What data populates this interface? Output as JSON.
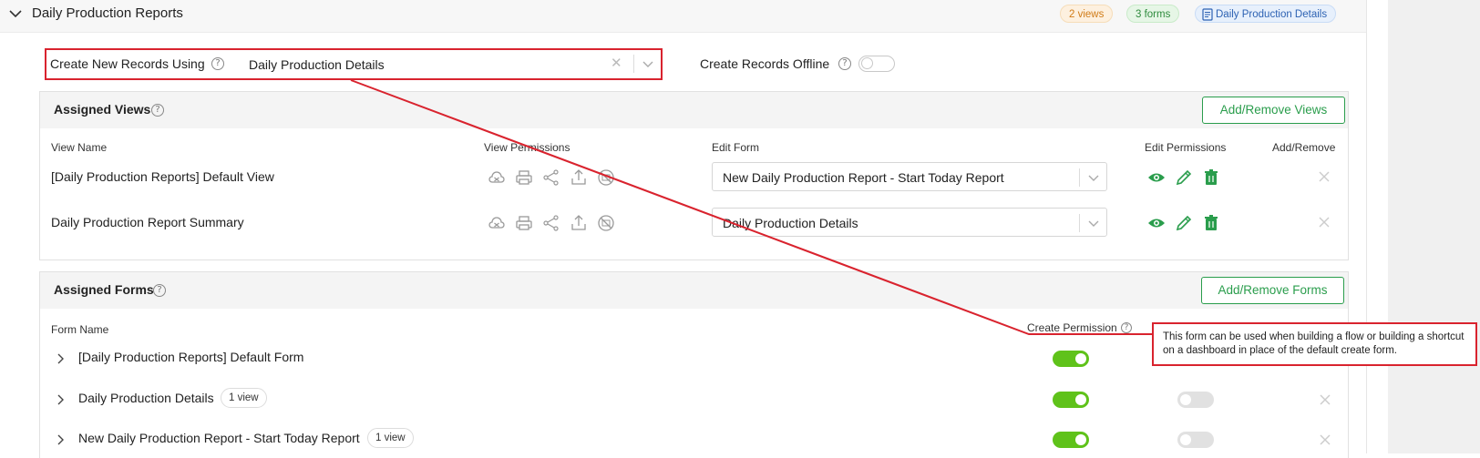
{
  "header": {
    "title": "Daily Production Reports",
    "badges": {
      "views": "2 views",
      "forms": "3 forms",
      "details": "Daily Production Details"
    }
  },
  "create_new": {
    "label": "Create New Records Using",
    "value": "Daily Production Details"
  },
  "offline": {
    "label": "Create Records Offline",
    "enabled": false
  },
  "assigned_views": {
    "title": "Assigned Views",
    "button": "Add/Remove Views",
    "columns": {
      "name": "View Name",
      "permissions": "View Permissions",
      "edit_form": "Edit Form",
      "edit_permissions": "Edit Permissions",
      "add_remove": "Add/Remove"
    },
    "rows": [
      {
        "name": "[Daily Production Reports] Default View",
        "edit_form": "New Daily Production Report - Start Today Report"
      },
      {
        "name": "Daily Production Report Summary",
        "edit_form": "Daily Production Details"
      }
    ]
  },
  "assigned_forms": {
    "title": "Assigned Forms",
    "button": "Add/Remove Forms",
    "columns": {
      "name": "Form Name",
      "create_permission": "Create Permission"
    },
    "rows": [
      {
        "name": "[Daily Production Reports] Default Form",
        "chip": "",
        "create": true
      },
      {
        "name": "Daily Production Details",
        "chip": "1 view",
        "create": true
      },
      {
        "name": "New Daily Production Report - Start Today Report",
        "chip": "1 view",
        "create": true
      }
    ]
  },
  "tooltip": {
    "text": "This form can be used when building a flow or building a shortcut on a dashboard in place of the default create form."
  },
  "colors": {
    "accent_green": "#2a9d4c",
    "toggle_on": "#5fc21a",
    "highlight_red": "#d9232e"
  }
}
